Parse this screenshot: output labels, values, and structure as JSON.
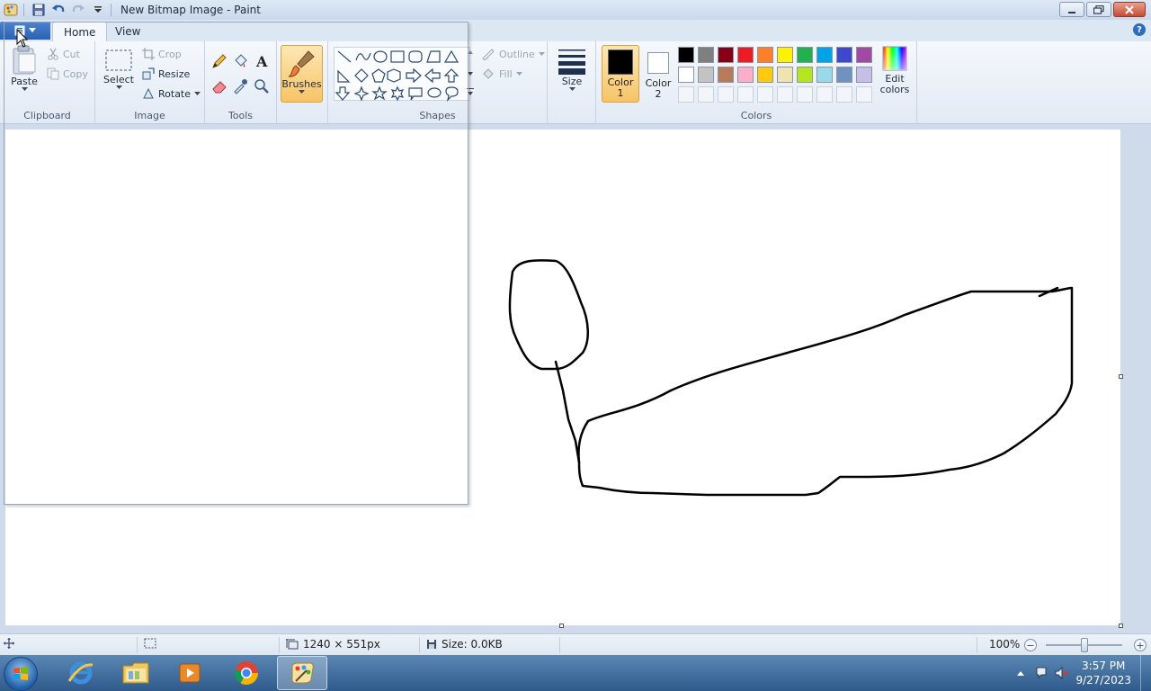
{
  "window": {
    "title": "New Bitmap Image - Paint",
    "controls": [
      "minimize",
      "restore",
      "close"
    ]
  },
  "tabs": [
    {
      "label": "Home",
      "active": true
    },
    {
      "label": "View",
      "active": false
    }
  ],
  "clipboard": {
    "group_label": "Clipboard",
    "paste_label": "Paste",
    "cut_label": "Cut",
    "copy_label": "Copy"
  },
  "image_group": {
    "group_label": "Image",
    "select_label": "Select",
    "crop_label": "Crop",
    "resize_label": "Resize",
    "rotate_label": "Rotate"
  },
  "tools_group": {
    "group_label": "Tools",
    "icons": [
      "pencil-icon",
      "fill-icon",
      "text-icon",
      "eraser-icon",
      "color-picker-icon",
      "magnifier-icon"
    ]
  },
  "brushes": {
    "label": "Brushes"
  },
  "shapes_group": {
    "group_label": "Shapes",
    "outline_label": "Outline",
    "fill_label": "Fill"
  },
  "size": {
    "label": "Size"
  },
  "colors_group": {
    "group_label": "Colors",
    "color1_label": "Color 1",
    "color2_label": "Color 2",
    "color1_value": "#000000",
    "color2_value": "#ffffff",
    "edit_colors_label": "Edit colors",
    "palette_row1": [
      "#000000",
      "#7f7f7f",
      "#880015",
      "#ed1c24",
      "#ff7f27",
      "#fff200",
      "#22b14c",
      "#00a2e8",
      "#3f48cc",
      "#a349a4"
    ],
    "palette_row2": [
      "#ffffff",
      "#c3c3c3",
      "#b97a57",
      "#ffaec9",
      "#ffc90e",
      "#efe4b0",
      "#b5e61d",
      "#99d9ea",
      "#7092be",
      "#c8bfe7"
    ]
  },
  "status": {
    "dimensions": "1240 × 551px",
    "size": "Size: 0.0KB",
    "zoom": "100%",
    "zoom_level_percent": 100
  },
  "taskbar": {
    "apps": [
      "internet-explorer",
      "file-explorer",
      "media-player",
      "chrome",
      "paint"
    ],
    "time": "3:57 PM",
    "date": "9/27/2023"
  }
}
